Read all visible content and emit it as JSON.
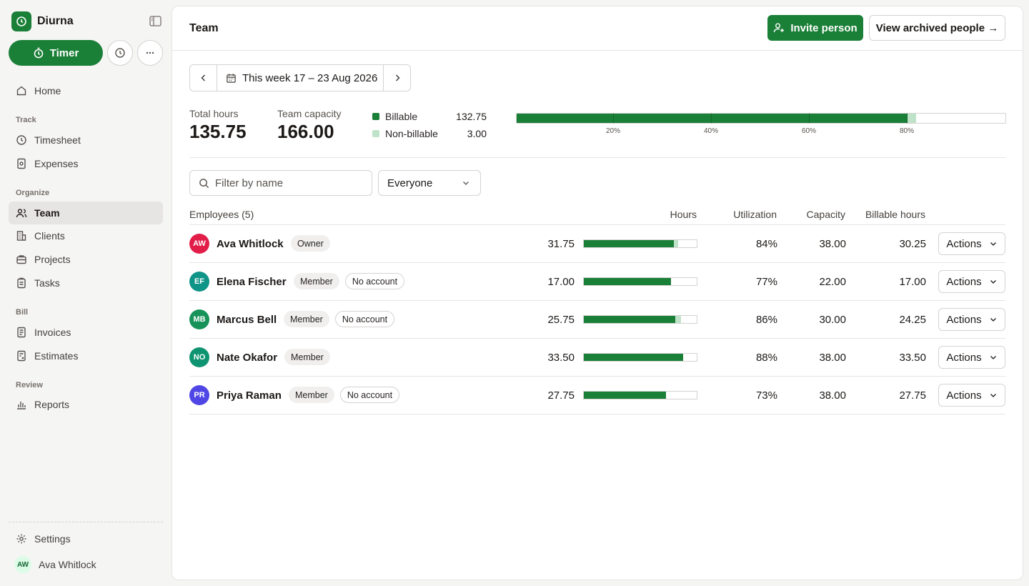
{
  "app": {
    "name": "Diurna"
  },
  "sidebar": {
    "timer_label": "Timer",
    "home": "Home",
    "sections": {
      "track": "Track",
      "organize": "Organize",
      "bill": "Bill",
      "review": "Review"
    },
    "items": {
      "timesheet": "Timesheet",
      "expenses": "Expenses",
      "team": "Team",
      "clients": "Clients",
      "projects": "Projects",
      "tasks": "Tasks",
      "invoices": "Invoices",
      "estimates": "Estimates",
      "reports": "Reports"
    },
    "settings": "Settings",
    "user": {
      "initials": "AW",
      "name": "Ava Whitlock"
    }
  },
  "header": {
    "title": "Team",
    "invite_label": "Invite person",
    "archived_label": "View archived people →"
  },
  "week": {
    "range": "This week 17 – 23 Aug 2026"
  },
  "stats": {
    "total_hours_label": "Total hours",
    "total_hours": "135.75",
    "capacity_label": "Team capacity",
    "capacity": "166.00",
    "billable_label": "Billable",
    "billable": "132.75",
    "nonbillable_label": "Non-billable",
    "nonbillable": "3.00",
    "bar": {
      "billable_pct": 79.97,
      "nonbillable_pct": 1.81
    },
    "ticks": [
      "20%",
      "40%",
      "60%",
      "80%"
    ]
  },
  "colors": {
    "accent": "#1a7f37",
    "nonbillable": "#bfe3c8"
  },
  "filters": {
    "search_placeholder": "Filter by name",
    "scope": "Everyone"
  },
  "table": {
    "headers": {
      "employees": "Employees (5)",
      "hours": "Hours",
      "utilization": "Utilization",
      "capacity": "Capacity",
      "billable": "Billable hours"
    },
    "actions_label": "Actions",
    "rows": [
      {
        "initials": "AW",
        "name": "Ava Whitlock",
        "color": "#e11d48",
        "badges": [
          "Owner"
        ],
        "outline_badges": [],
        "hours": "31.75",
        "billable_fraction": 0.7961,
        "nonbillable_fraction": 0.0395,
        "utilization": "84%",
        "capacity": "38.00",
        "billable": "30.25"
      },
      {
        "initials": "EF",
        "name": "Elena Fischer",
        "color": "#0f9488",
        "badges": [
          "Member"
        ],
        "outline_badges": [
          "No account"
        ],
        "hours": "17.00",
        "billable_fraction": 0.7727,
        "nonbillable_fraction": 0,
        "utilization": "77%",
        "capacity": "22.00",
        "billable": "17.00"
      },
      {
        "initials": "MB",
        "name": "Marcus Bell",
        "color": "#17935a",
        "badges": [
          "Member"
        ],
        "outline_badges": [
          "No account"
        ],
        "hours": "25.75",
        "billable_fraction": 0.8083,
        "nonbillable_fraction": 0.05,
        "utilization": "86%",
        "capacity": "30.00",
        "billable": "24.25"
      },
      {
        "initials": "NO",
        "name": "Nate Okafor",
        "color": "#0f9471",
        "badges": [
          "Member"
        ],
        "outline_badges": [],
        "hours": "33.50",
        "billable_fraction": 0.8816,
        "nonbillable_fraction": 0,
        "utilization": "88%",
        "capacity": "38.00",
        "billable": "33.50"
      },
      {
        "initials": "PR",
        "name": "Priya Raman",
        "color": "#4f46e5",
        "badges": [
          "Member"
        ],
        "outline_badges": [
          "No account"
        ],
        "hours": "27.75",
        "billable_fraction": 0.7303,
        "nonbillable_fraction": 0,
        "utilization": "73%",
        "capacity": "38.00",
        "billable": "27.75"
      }
    ]
  }
}
